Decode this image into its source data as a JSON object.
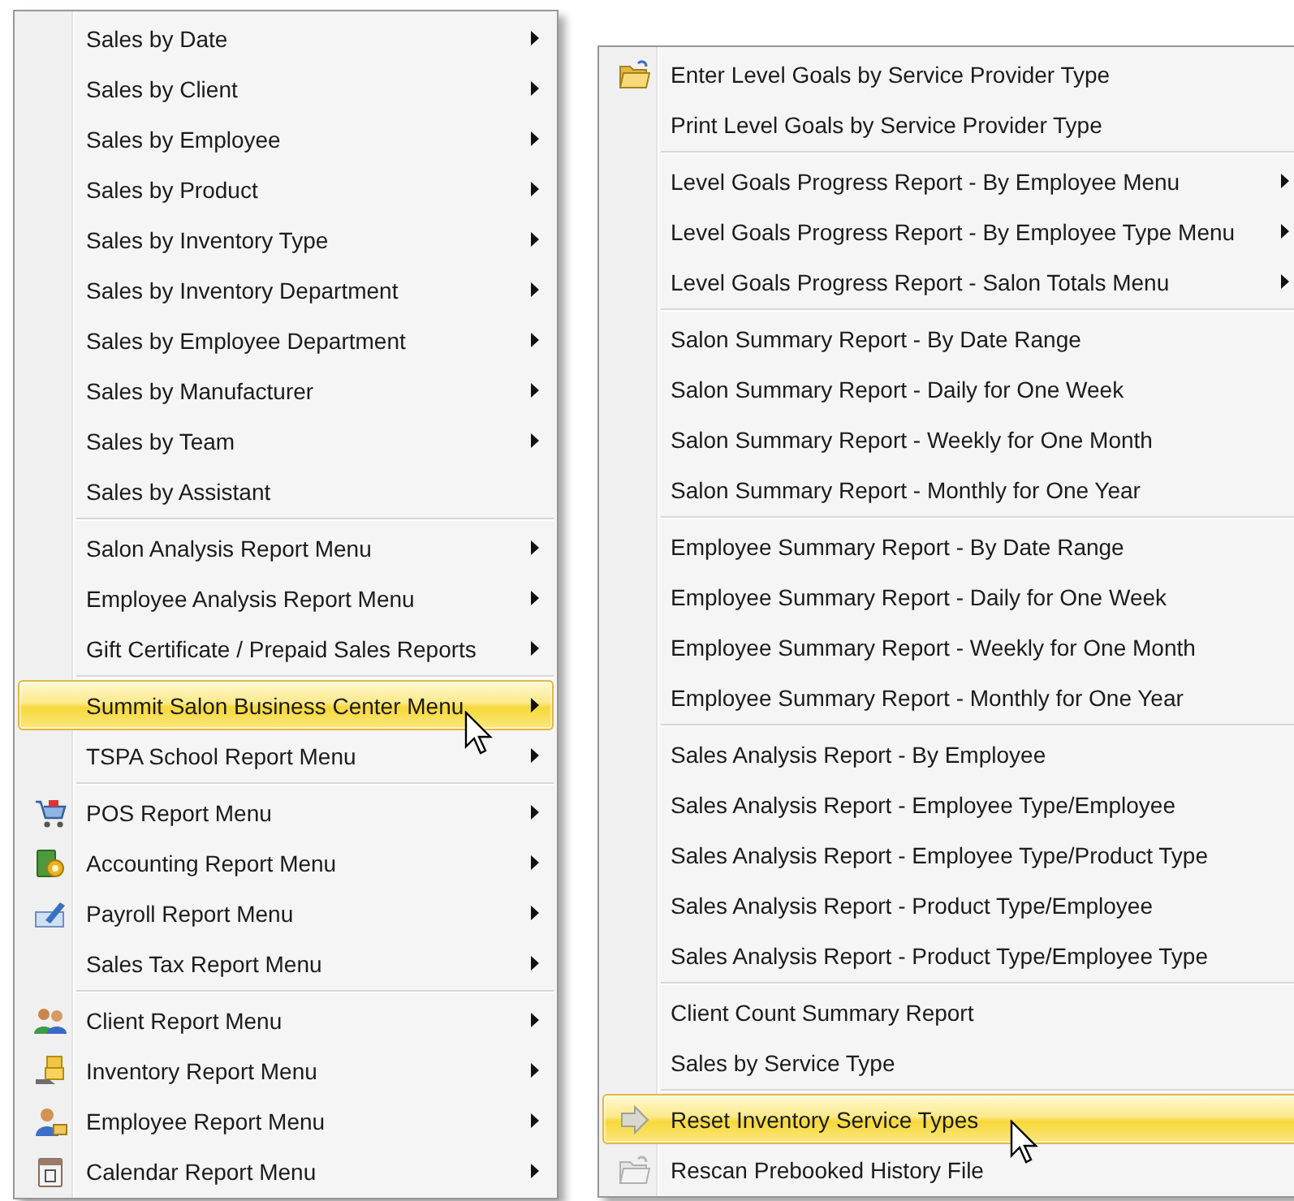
{
  "left_menu": {
    "groups": [
      {
        "items": [
          {
            "label": "Sales by Date",
            "submenu": true,
            "selected": false
          },
          {
            "label": "Sales by Client",
            "submenu": true,
            "selected": false
          },
          {
            "label": "Sales by Employee",
            "submenu": true,
            "selected": false
          },
          {
            "label": "Sales by Product",
            "submenu": true,
            "selected": false
          },
          {
            "label": "Sales by Inventory Type",
            "submenu": true,
            "selected": false
          },
          {
            "label": "Sales by Inventory Department",
            "submenu": true,
            "selected": false
          },
          {
            "label": "Sales by Employee Department",
            "submenu": true,
            "selected": false
          },
          {
            "label": "Sales by Manufacturer",
            "submenu": true,
            "selected": false
          },
          {
            "label": "Sales by Team",
            "submenu": true,
            "selected": false
          },
          {
            "label": "Sales by Assistant",
            "submenu": false,
            "selected": false
          }
        ]
      },
      {
        "items": [
          {
            "label": "Salon Analysis Report Menu",
            "submenu": true,
            "selected": false
          },
          {
            "label": "Employee Analysis Report Menu",
            "submenu": true,
            "selected": false
          },
          {
            "label": "Gift Certificate / Prepaid Sales Reports",
            "submenu": true,
            "selected": false
          }
        ]
      },
      {
        "items": [
          {
            "label": "Summit Salon Business Center Menu",
            "submenu": true,
            "selected": true
          },
          {
            "label": "TSPA School Report Menu",
            "submenu": true,
            "selected": false
          }
        ]
      },
      {
        "items": [
          {
            "label": "POS Report Menu",
            "submenu": true,
            "selected": false
          },
          {
            "label": "Accounting Report Menu",
            "submenu": true,
            "selected": false
          },
          {
            "label": "Payroll Report Menu",
            "submenu": true,
            "selected": false
          },
          {
            "label": "Sales Tax Report Menu",
            "submenu": true,
            "selected": false
          }
        ]
      },
      {
        "items": [
          {
            "label": "Client Report Menu",
            "submenu": true,
            "selected": false
          },
          {
            "label": "Inventory Report Menu",
            "submenu": true,
            "selected": false
          },
          {
            "label": "Employee Report Menu",
            "submenu": true,
            "selected": false
          },
          {
            "label": "Calendar Report Menu",
            "submenu": true,
            "selected": false
          }
        ]
      }
    ]
  },
  "right_menu": {
    "groups": [
      {
        "items": [
          {
            "label": "Enter Level Goals by Service Provider Type",
            "submenu": false,
            "selected": false
          },
          {
            "label": "Print Level Goals by Service Provider Type",
            "submenu": false,
            "selected": false
          }
        ]
      },
      {
        "items": [
          {
            "label": "Level Goals Progress Report - By Employee Menu",
            "submenu": true,
            "selected": false
          },
          {
            "label": "Level Goals Progress Report - By Employee Type Menu",
            "submenu": true,
            "selected": false
          },
          {
            "label": "Level Goals Progress Report - Salon Totals Menu",
            "submenu": true,
            "selected": false
          }
        ]
      },
      {
        "items": [
          {
            "label": "Salon Summary Report - By Date Range",
            "submenu": false,
            "selected": false
          },
          {
            "label": "Salon Summary Report - Daily for One Week",
            "submenu": false,
            "selected": false
          },
          {
            "label": "Salon Summary Report - Weekly for One Month",
            "submenu": false,
            "selected": false
          },
          {
            "label": "Salon Summary Report - Monthly for One Year",
            "submenu": false,
            "selected": false
          }
        ]
      },
      {
        "items": [
          {
            "label": "Employee Summary Report - By Date Range",
            "submenu": false,
            "selected": false
          },
          {
            "label": "Employee Summary Report - Daily for One Week",
            "submenu": false,
            "selected": false
          },
          {
            "label": "Employee Summary Report - Weekly for One Month",
            "submenu": false,
            "selected": false
          },
          {
            "label": "Employee Summary Report - Monthly for One Year",
            "submenu": false,
            "selected": false
          }
        ]
      },
      {
        "items": [
          {
            "label": "Sales Analysis Report - By Employee",
            "submenu": false,
            "selected": false
          },
          {
            "label": "Sales Analysis Report - Employee Type/Employee",
            "submenu": false,
            "selected": false
          },
          {
            "label": "Sales Analysis Report - Employee Type/Product Type",
            "submenu": false,
            "selected": false
          },
          {
            "label": "Sales Analysis Report - Product Type/Employee",
            "submenu": false,
            "selected": false
          },
          {
            "label": "Sales Analysis Report - Product Type/Employee Type",
            "submenu": false,
            "selected": false
          }
        ]
      },
      {
        "items": [
          {
            "label": "Client Count Summary Report",
            "submenu": false,
            "selected": false
          },
          {
            "label": "Sales by Service Type",
            "submenu": false,
            "selected": false
          }
        ]
      },
      {
        "items": [
          {
            "label": "Reset Inventory Service Types",
            "submenu": false,
            "selected": true
          },
          {
            "label": "Rescan Prebooked History File",
            "submenu": false,
            "selected": false
          }
        ]
      }
    ]
  }
}
